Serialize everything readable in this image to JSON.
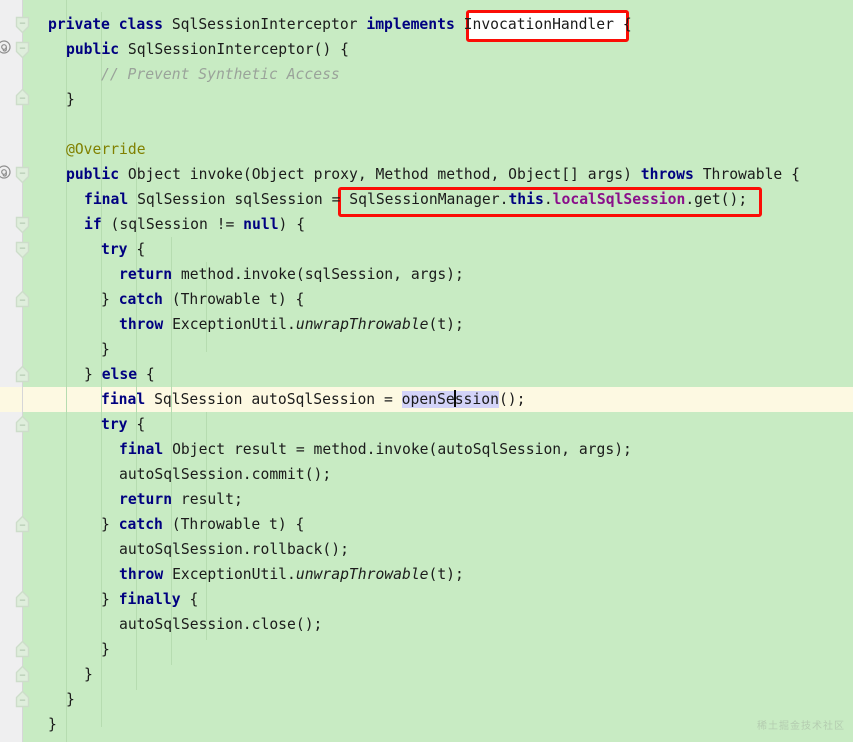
{
  "editor": {
    "theme_background": "#c8ebc3",
    "gutter_background": "#efeff0",
    "current_line_background": "#fdf9e2",
    "selection_background": "#d3d3f8",
    "annotation_color": "#fb0d06",
    "keyword_color": "#000080",
    "comment_color": "#9aa39a",
    "field_color": "#8a0f8a",
    "annotation_text_color": "#808000"
  },
  "watermark": {
    "text": "稀土掘金技术社区"
  },
  "annotations": [
    {
      "name": "invocation-handler-box",
      "label": "InvocationHandler"
    },
    {
      "name": "local-sql-session-box",
      "label": "= SqlSessionManager.this.localSqlSession.get();"
    }
  ],
  "cursor": {
    "line": 16,
    "column": 47,
    "selected_text": "openSession"
  },
  "gutter_icons": [
    {
      "name": "override-marker",
      "line": 2
    },
    {
      "name": "override-marker",
      "line": 8
    }
  ],
  "fold_markers": [
    {
      "line": 1,
      "state": "expanded",
      "direction": "down"
    },
    {
      "line": 2,
      "state": "expanded",
      "direction": "down"
    },
    {
      "line": 4,
      "state": "expanded",
      "direction": "up"
    },
    {
      "line": 8,
      "state": "expanded",
      "direction": "down"
    },
    {
      "line": 10,
      "state": "expanded",
      "direction": "down"
    },
    {
      "line": 11,
      "state": "expanded",
      "direction": "down"
    },
    {
      "line": 14,
      "state": "expanded",
      "direction": "up"
    },
    {
      "line": 23,
      "state": "expanded",
      "direction": "up"
    },
    {
      "line": 26,
      "state": "expanded",
      "direction": "up"
    },
    {
      "line": 27,
      "state": "expanded",
      "direction": "up"
    },
    {
      "line": 28,
      "state": "expanded",
      "direction": "up"
    },
    {
      "line": 29,
      "state": "expanded",
      "direction": "up"
    }
  ],
  "code": {
    "language": "java",
    "lines": [
      {
        "n": 1,
        "indent": 1,
        "text": "private class SqlSessionInterceptor implements InvocationHandler {"
      },
      {
        "n": 2,
        "indent": 2,
        "text": "public SqlSessionInterceptor() {"
      },
      {
        "n": 3,
        "indent": 3,
        "text": "// Prevent Synthetic Access"
      },
      {
        "n": 4,
        "indent": 2,
        "text": "}"
      },
      {
        "n": 5,
        "indent": 0,
        "text": ""
      },
      {
        "n": 6,
        "indent": 0,
        "text": ""
      },
      {
        "n": 7,
        "indent": 2,
        "text": "@Override"
      },
      {
        "n": 8,
        "indent": 2,
        "text": "public Object invoke(Object proxy, Method method, Object[] args) throws Throwable {"
      },
      {
        "n": 9,
        "indent": 3,
        "text": "final SqlSession sqlSession = SqlSessionManager.this.localSqlSession.get();"
      },
      {
        "n": 10,
        "indent": 3,
        "text": "if (sqlSession != null) {"
      },
      {
        "n": 11,
        "indent": 4,
        "text": "try {"
      },
      {
        "n": 12,
        "indent": 5,
        "text": "return method.invoke(sqlSession, args);"
      },
      {
        "n": 13,
        "indent": 4,
        "text": "} catch (Throwable t) {"
      },
      {
        "n": 14,
        "indent": 5,
        "text": "throw ExceptionUtil.unwrapThrowable(t);"
      },
      {
        "n": 15,
        "indent": 4,
        "text": "}"
      },
      {
        "n": 16,
        "indent": 3,
        "text": "} else {"
      },
      {
        "n": 17,
        "indent": 4,
        "text": "final SqlSession autoSqlSession = openSession();"
      },
      {
        "n": 18,
        "indent": 4,
        "text": "try {"
      },
      {
        "n": 19,
        "indent": 5,
        "text": "final Object result = method.invoke(autoSqlSession, args);"
      },
      {
        "n": 20,
        "indent": 5,
        "text": "autoSqlSession.commit();"
      },
      {
        "n": 21,
        "indent": 5,
        "text": "return result;"
      },
      {
        "n": 22,
        "indent": 4,
        "text": "} catch (Throwable t) {"
      },
      {
        "n": 23,
        "indent": 5,
        "text": "autoSqlSession.rollback();"
      },
      {
        "n": 24,
        "indent": 5,
        "text": "throw ExceptionUtil.unwrapThrowable(t);"
      },
      {
        "n": 25,
        "indent": 4,
        "text": "} finally {"
      },
      {
        "n": 26,
        "indent": 5,
        "text": "autoSqlSession.close();"
      },
      {
        "n": 27,
        "indent": 4,
        "text": "}"
      },
      {
        "n": 28,
        "indent": 3,
        "text": "}"
      },
      {
        "n": 29,
        "indent": 2,
        "text": "}"
      },
      {
        "n": 30,
        "indent": 1,
        "text": "}"
      }
    ]
  }
}
